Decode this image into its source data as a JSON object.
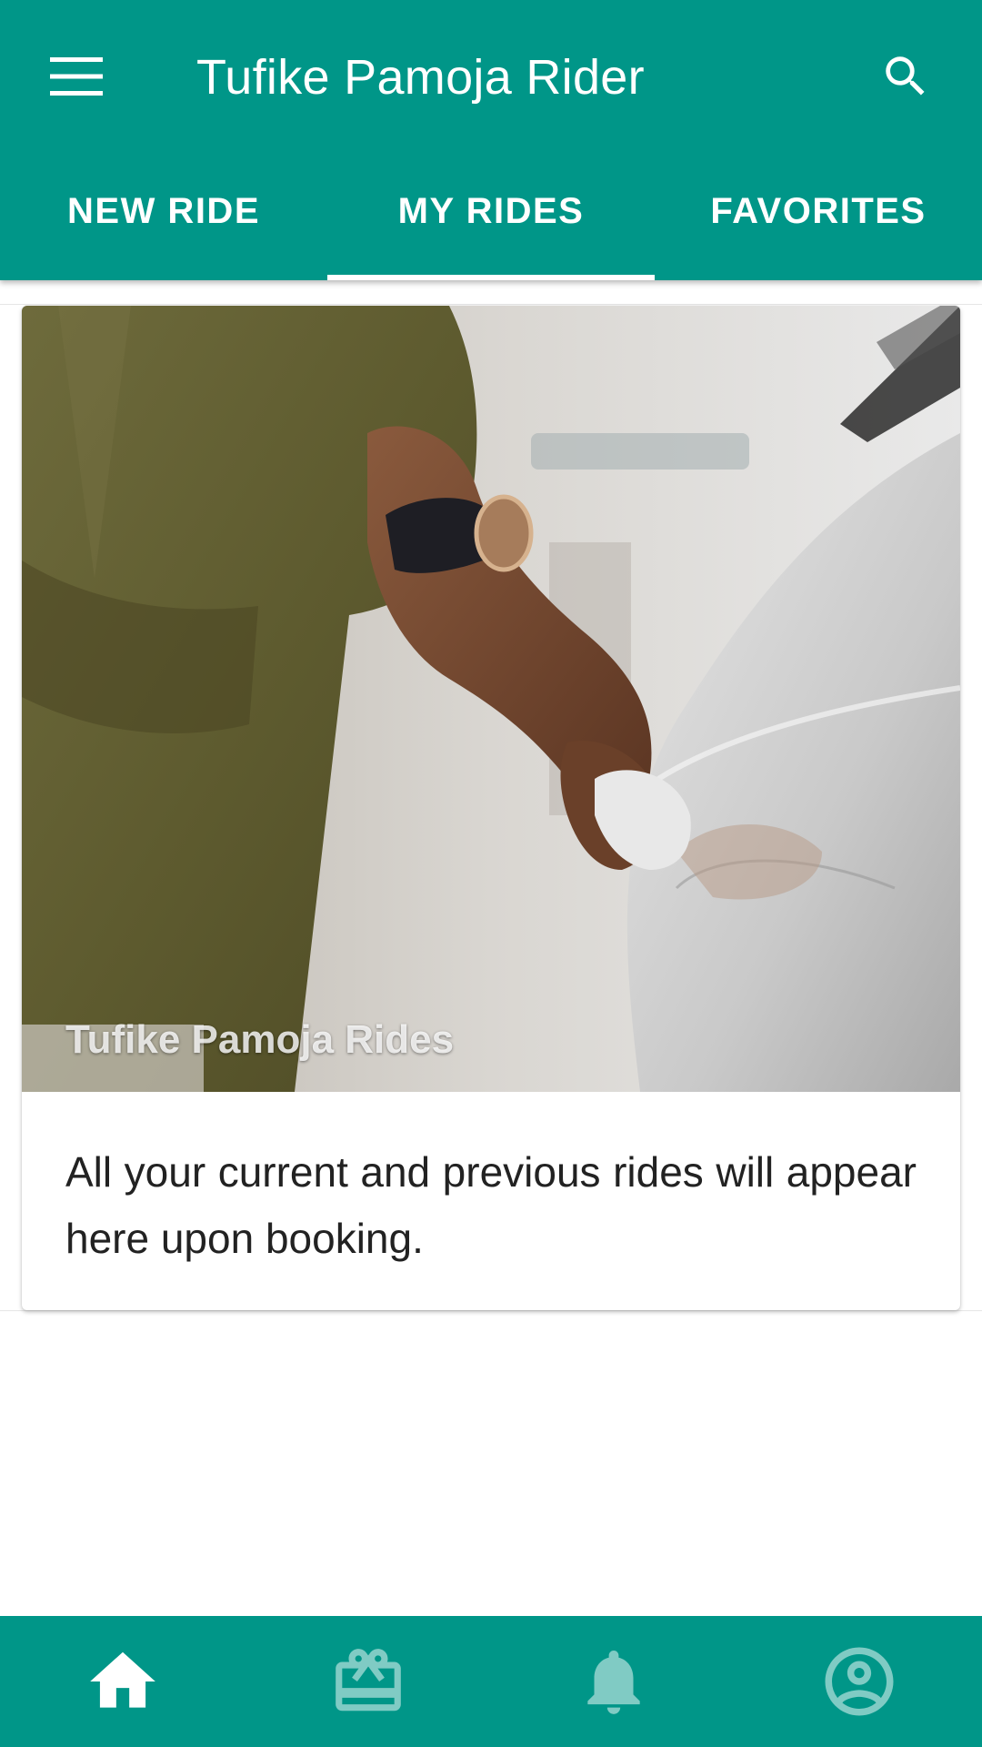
{
  "appbar": {
    "title": "Tufike Pamoja Rider",
    "menu_icon": "menu-icon",
    "search_icon": "search-icon"
  },
  "tabs": [
    {
      "label": "NEW RIDE",
      "active": false
    },
    {
      "label": "MY RIDES",
      "active": true
    },
    {
      "label": "FAVORITES",
      "active": false
    }
  ],
  "card": {
    "image_caption": "Tufike Pamoja Rides",
    "message": "All your current and previous rides will appear here upon booking."
  },
  "bottom_nav": [
    {
      "icon": "home-icon",
      "active": true
    },
    {
      "icon": "gift-card-icon",
      "active": false
    },
    {
      "icon": "bell-icon",
      "active": false
    },
    {
      "icon": "account-circle-icon",
      "active": false
    }
  ],
  "colors": {
    "primary": "#009688",
    "on_primary": "#ffffff",
    "inactive_icon": "#80cbc4",
    "text": "#222222"
  }
}
